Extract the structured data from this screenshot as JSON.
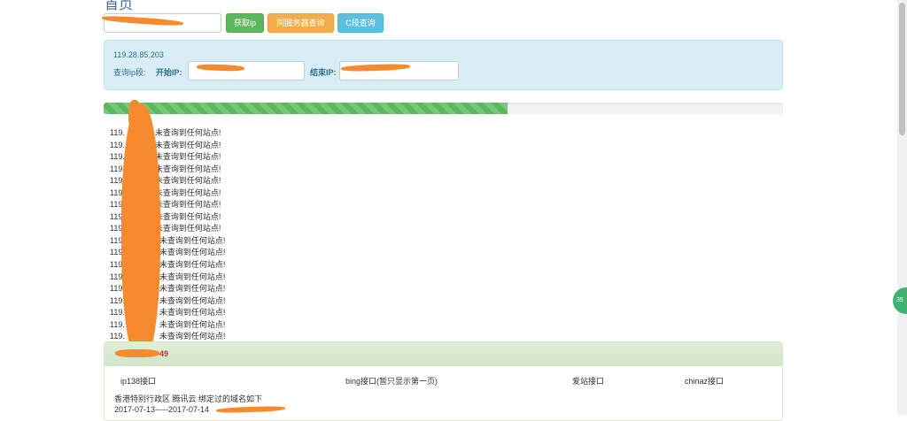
{
  "page": {
    "title": "首页"
  },
  "toolbar": {
    "domain_value": "",
    "get_ip_label": "获取ip",
    "same_server_label": "同服务器查询",
    "c_segment_label": "C段查询"
  },
  "info": {
    "ip": "119.28.85.203",
    "range_label": "查询ip段:",
    "start_label": "开始IP:",
    "start_value": "",
    "end_label": "结束IP:",
    "end_value": ""
  },
  "progress": {
    "fraction": 0.595
  },
  "results": {
    "lines": [
      {
        "prefix": "119.",
        "suffix": "未查询到任何站点!"
      },
      {
        "prefix": "119.",
        "suffix": "未查询到任何站点!"
      },
      {
        "prefix": "119.",
        "suffix": "未查询到任何站点!"
      },
      {
        "prefix": "119.",
        "suffix": "未查询到任何站点!"
      },
      {
        "prefix": "119.",
        "suffix": "未查询到任何站点!"
      },
      {
        "prefix": "119.",
        "suffix": "未查询到任何站点!"
      },
      {
        "prefix": "119.",
        "suffix": "未查询到任何站点!"
      },
      {
        "prefix": "119.",
        "suffix": "未查询到任何站点!"
      },
      {
        "prefix": "119.",
        "suffix": "未查询到任何站点!"
      },
      {
        "prefix": "119.",
        "suffix": "未查询到任何站点!"
      },
      {
        "prefix": "119.",
        "suffix": "未查询到任何站点!"
      },
      {
        "prefix": "119.",
        "suffix": "未查询到任何站点!"
      },
      {
        "prefix": "119.",
        "suffix": "未查询到任何站点!"
      },
      {
        "prefix": "119.",
        "suffix": "未查询到任何站点!"
      },
      {
        "prefix": "119.",
        "suffix": "未查询到任何站点!"
      },
      {
        "prefix": "119.",
        "suffix": "未查询到任何站点!"
      },
      {
        "prefix": "119.",
        "suffix": "未查询到任何站点!"
      },
      {
        "prefix": "119.",
        "suffix": "未查询到任何站点!"
      }
    ]
  },
  "success": {
    "heading_suffix": "49",
    "api_links": [
      "ip138接口",
      "bing接口(暂只显示第一页)",
      "爱站接口",
      "chinaz接口"
    ],
    "region_text": "香港特别行政区 腾讯云 绑定过的域名如下",
    "date_text": "2017-07-13-----2017-07-14"
  },
  "side_badge": {
    "text": "35"
  },
  "colors": {
    "redaction": "#f58a2f",
    "info_panel_bg": "#d9edf7",
    "success_heading_bg": "#dff0d8",
    "progress_fill": "#5cb85c"
  }
}
